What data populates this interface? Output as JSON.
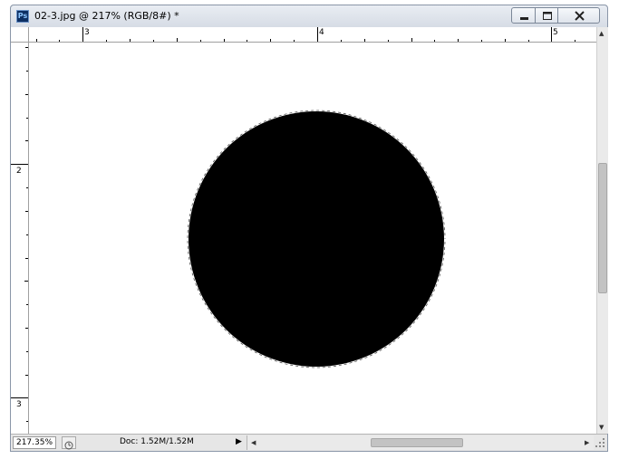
{
  "window": {
    "title": "02-3.jpg @ 217% (RGB/8#) *",
    "app_icon_text": "Ps"
  },
  "rulers": {
    "top_labels": [
      "3",
      "4",
      "5"
    ],
    "left_labels": [
      "2",
      "3"
    ]
  },
  "status_bar": {
    "zoom": "217.35%",
    "doc_info": "Doc: 1.52M/1.52M",
    "menu_arrow": "▶"
  },
  "icons": {
    "app": "photoshop-icon",
    "minimize": "minimize-icon",
    "maximize": "maximize-icon",
    "close": "close-icon",
    "status": "timer-icon"
  },
  "colors": {
    "shape_fill": "#000000",
    "canvas": "#ffffff",
    "selection": "#ffffff"
  }
}
